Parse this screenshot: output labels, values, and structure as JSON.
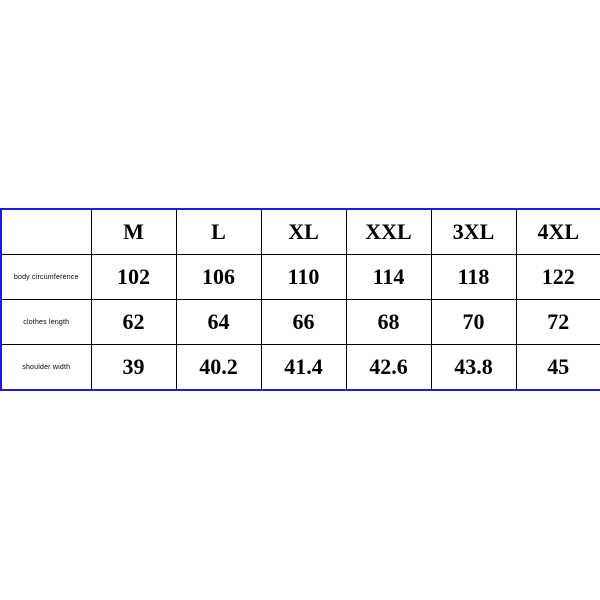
{
  "chart_data": {
    "type": "table",
    "title": "",
    "columns": [
      "M",
      "L",
      "XL",
      "XXL",
      "3XL",
      "4XL"
    ],
    "rows": [
      {
        "label": "body circumference",
        "values": [
          102,
          106,
          110,
          114,
          118,
          122
        ]
      },
      {
        "label": "clothes length",
        "values": [
          62,
          64,
          66,
          68,
          70,
          72
        ]
      },
      {
        "label": "shoulder width",
        "values": [
          39,
          40.2,
          41.4,
          42.6,
          43.8,
          45
        ]
      }
    ]
  }
}
